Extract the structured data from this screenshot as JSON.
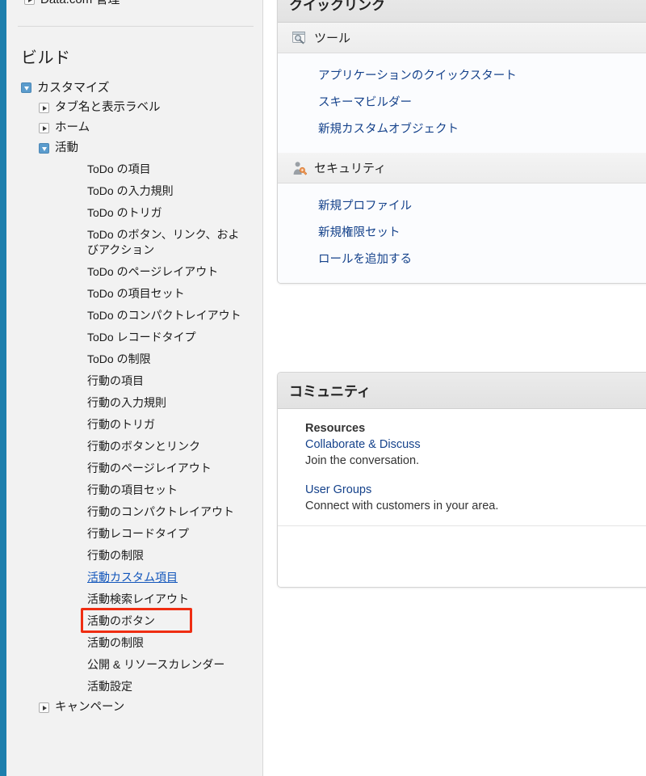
{
  "sidebar": {
    "clipped_top_item": {
      "label": "Data.com 管理",
      "icon": "triangle-right-icon",
      "state": "collapsed"
    },
    "section_title": "ビルド",
    "tree": [
      {
        "level": 0,
        "label": "カスタマイズ",
        "state": "expanded",
        "icon": "triangle-down-icon"
      },
      {
        "level": 1,
        "label": "タブ名と表示ラベル",
        "state": "collapsed",
        "icon": "triangle-right-icon"
      },
      {
        "level": 1,
        "label": "ホーム",
        "state": "collapsed",
        "icon": "triangle-right-icon"
      },
      {
        "level": 1,
        "label": "活動",
        "state": "expanded",
        "icon": "triangle-down-icon"
      }
    ],
    "leaves": [
      {
        "label": "ToDo の項目",
        "active": false
      },
      {
        "label": "ToDo の入力規則",
        "active": false
      },
      {
        "label": "ToDo のトリガ",
        "active": false
      },
      {
        "label": "ToDo のボタン、リンク、およびアクション",
        "active": false,
        "wrap": true
      },
      {
        "label": "ToDo のページレイアウト",
        "active": false
      },
      {
        "label": "ToDo の項目セット",
        "active": false
      },
      {
        "label": "ToDo のコンパクトレイアウト",
        "active": false
      },
      {
        "label": "ToDo レコードタイプ",
        "active": false
      },
      {
        "label": "ToDo の制限",
        "active": false
      },
      {
        "label": "行動の項目",
        "active": false
      },
      {
        "label": "行動の入力規則",
        "active": false
      },
      {
        "label": "行動のトリガ",
        "active": false
      },
      {
        "label": "行動のボタンとリンク",
        "active": false
      },
      {
        "label": "行動のページレイアウト",
        "active": false
      },
      {
        "label": "行動の項目セット",
        "active": false
      },
      {
        "label": "行動のコンパクトレイアウト",
        "active": false
      },
      {
        "label": "行動レコードタイプ",
        "active": false
      },
      {
        "label": "行動の制限",
        "active": false
      },
      {
        "label": "活動カスタム項目",
        "active": true
      },
      {
        "label": "活動検索レイアウト",
        "active": false
      },
      {
        "label": "活動のボタン",
        "active": false
      },
      {
        "label": "活動の制限",
        "active": false
      },
      {
        "label": "公開 & リソースカレンダー",
        "active": false
      },
      {
        "label": "活動設定",
        "active": false
      }
    ],
    "tree_tail": [
      {
        "level": 1,
        "label": "キャンペーン",
        "state": "collapsed",
        "icon": "triangle-right-icon"
      }
    ],
    "highlight": {
      "target": "活動カスタム項目",
      "color": "#ef2d12"
    }
  },
  "quicklinks": {
    "title": "クイックリンク",
    "groups": [
      {
        "icon": "tools-window-magnifier-icon",
        "label": "ツール",
        "links": [
          "アプリケーションのクイックスタート",
          "スキーマビルダー",
          "新規カスタムオブジェクト"
        ]
      },
      {
        "icon": "security-person-key-icon",
        "label": "セキュリティ",
        "links": [
          "新規プロファイル",
          "新規権限セット",
          "ロールを追加する"
        ]
      }
    ]
  },
  "community": {
    "title": "コミュニティ",
    "resources_heading": "Resources",
    "items": [
      {
        "link": "Collaborate & Discuss",
        "desc": "Join the conversation."
      },
      {
        "link": "User Groups",
        "desc": "Connect with customers in your area."
      }
    ]
  },
  "colors": {
    "rail": "#1e7fad",
    "sidebar_bg": "#f2f2f2",
    "link": "#15428b",
    "active_link": "#1155bb",
    "highlight": "#ef2d12"
  }
}
